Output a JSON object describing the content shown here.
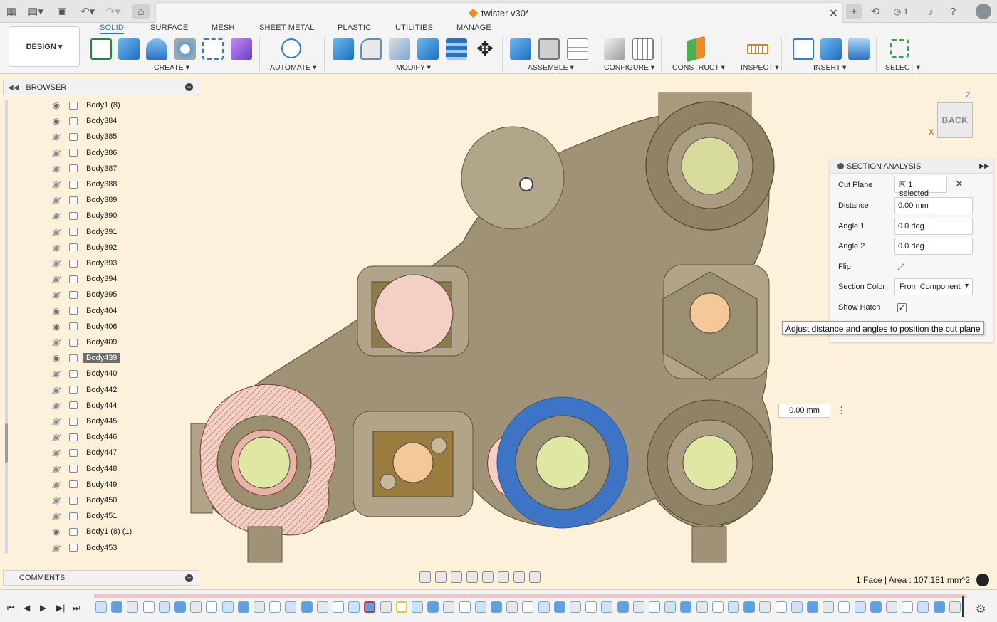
{
  "titlebar": {
    "doc_title": "twister v30*",
    "notification_count": "1"
  },
  "ribbon": {
    "workspace": "DESIGN",
    "tabs": [
      "SOLID",
      "SURFACE",
      "MESH",
      "SHEET METAL",
      "PLASTIC",
      "UTILITIES",
      "MANAGE"
    ],
    "groups": [
      "CREATE",
      "AUTOMATE",
      "MODIFY",
      "ASSEMBLE",
      "CONFIGURE",
      "CONSTRUCT",
      "INSPECT",
      "INSERT",
      "SELECT"
    ]
  },
  "browser": {
    "title": "BROWSER",
    "items": [
      {
        "name": "Body1 (8)",
        "visible": true,
        "selected": false
      },
      {
        "name": "Body384",
        "visible": true,
        "selected": false
      },
      {
        "name": "Body385",
        "visible": false,
        "selected": false
      },
      {
        "name": "Body386",
        "visible": false,
        "selected": false
      },
      {
        "name": "Body387",
        "visible": false,
        "selected": false
      },
      {
        "name": "Body388",
        "visible": false,
        "selected": false
      },
      {
        "name": "Body389",
        "visible": false,
        "selected": false
      },
      {
        "name": "Body390",
        "visible": false,
        "selected": false
      },
      {
        "name": "Body391",
        "visible": false,
        "selected": false
      },
      {
        "name": "Body392",
        "visible": false,
        "selected": false
      },
      {
        "name": "Body393",
        "visible": false,
        "selected": false
      },
      {
        "name": "Body394",
        "visible": false,
        "selected": false
      },
      {
        "name": "Body395",
        "visible": false,
        "selected": false
      },
      {
        "name": "Body404",
        "visible": true,
        "selected": false
      },
      {
        "name": "Body406",
        "visible": true,
        "selected": false
      },
      {
        "name": "Body409",
        "visible": false,
        "selected": false
      },
      {
        "name": "Body439",
        "visible": true,
        "selected": true
      },
      {
        "name": "Body440",
        "visible": false,
        "selected": false
      },
      {
        "name": "Body442",
        "visible": false,
        "selected": false
      },
      {
        "name": "Body444",
        "visible": false,
        "selected": false
      },
      {
        "name": "Body445",
        "visible": false,
        "selected": false
      },
      {
        "name": "Body446",
        "visible": false,
        "selected": false
      },
      {
        "name": "Body447",
        "visible": false,
        "selected": false
      },
      {
        "name": "Body448",
        "visible": false,
        "selected": false
      },
      {
        "name": "Body449",
        "visible": false,
        "selected": false
      },
      {
        "name": "Body450",
        "visible": false,
        "selected": false
      },
      {
        "name": "Body451",
        "visible": false,
        "selected": false
      },
      {
        "name": "Body1 (8) (1)",
        "visible": true,
        "selected": false
      },
      {
        "name": "Body453",
        "visible": false,
        "selected": false
      }
    ]
  },
  "comments": {
    "title": "COMMENTS"
  },
  "viewcube": {
    "face": "BACK",
    "axis_z": "Z",
    "axis_x": "X"
  },
  "section_analysis": {
    "title": "SECTION ANALYSIS",
    "cut_plane_label": "Cut Plane",
    "cut_plane_value": "1 selected",
    "distance_label": "Distance",
    "distance_value": "0.00 mm",
    "angle1_label": "Angle 1",
    "angle1_value": "0.0 deg",
    "angle2_label": "Angle 2",
    "angle2_value": "0.0 deg",
    "flip_label": "Flip",
    "section_color_label": "Section Color",
    "section_color_value": "From Component",
    "show_hatch_label": "Show Hatch",
    "show_hatch_checked": true
  },
  "tooltip": "Adjust distance and angles to position the cut plane",
  "viewport_distance": "0.00 mm",
  "status": "1 Face | Area : 107.181 mm^2",
  "colors": {
    "accent": "#1a78d2",
    "viewport_bg": "#fdf1dc",
    "model": "#9b8f72",
    "hatch_green": "#dfe7a2",
    "hatch_orange": "#f5c89a",
    "hatch_pink": "#f3cfc4",
    "highlight_blue": "#3d74c6"
  }
}
